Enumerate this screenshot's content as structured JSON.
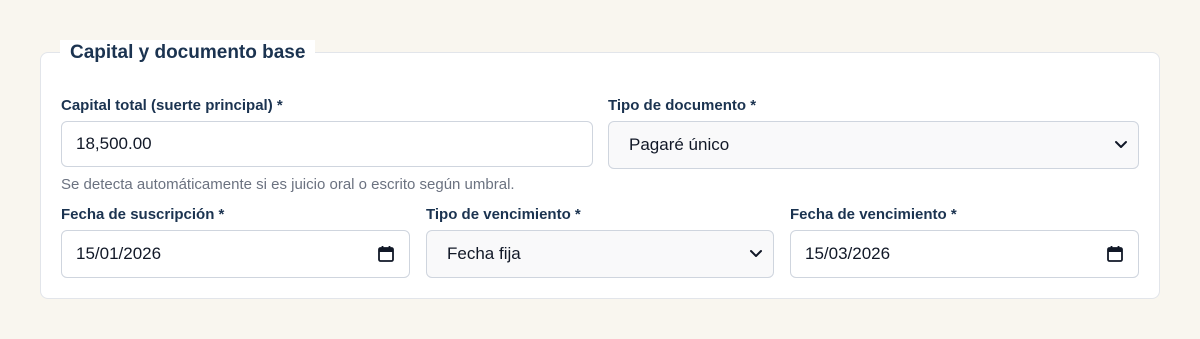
{
  "section": {
    "legend": "Capital y documento base"
  },
  "fields": {
    "capital": {
      "label": "Capital total (suerte principal) *",
      "value": "18,500.00",
      "help": "Se detecta automáticamente si es juicio oral o escrito según umbral."
    },
    "tipo_documento": {
      "label": "Tipo de documento *",
      "selected": "Pagaré único"
    },
    "fecha_suscripcion": {
      "label": "Fecha de suscripción *",
      "value": "15/01/2026"
    },
    "tipo_vencimiento": {
      "label": "Tipo de vencimiento *",
      "selected": "Fecha fija"
    },
    "fecha_vencimiento": {
      "label": "Fecha de vencimiento *",
      "value": "15/03/2026"
    }
  },
  "icons": {
    "select_arrow": "chevron-down-icon",
    "date_picker": "calendar-icon"
  },
  "colors": {
    "page_background": "#f9f6ef",
    "label_text": "#1b3350",
    "help_text": "#6b7280",
    "border": "#cfd5de"
  }
}
